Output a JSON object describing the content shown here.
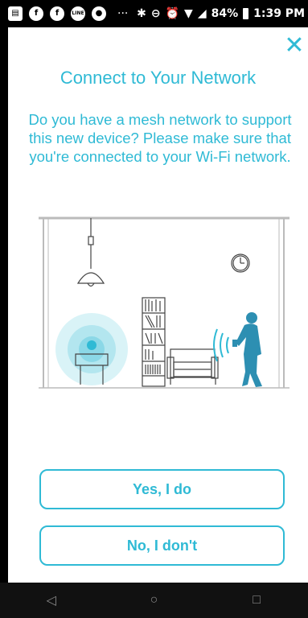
{
  "status_bar": {
    "battery": "84%",
    "time": "1:39 PM",
    "overflow": "···",
    "left_icons": [
      "notes-icon",
      "facebook-icon",
      "facebook-icon",
      "line-icon",
      "messenger-icon"
    ],
    "right_icons": [
      "bluetooth-icon",
      "do-not-disturb-icon",
      "alarm-icon",
      "wifi-icon",
      "signal-icon",
      "battery-icon"
    ]
  },
  "dialog": {
    "title": "Connect to Your Network",
    "description": "Do you have a mesh network to support this new device? Please make sure that you're connected to your Wi-Fi network.",
    "yes_label": "Yes, I do",
    "no_label": "No, I don't",
    "close_icon": "close-icon"
  },
  "illustration": {
    "icons": [
      "pendant-lamp-icon",
      "wall-clock-icon",
      "bookshelf-icon",
      "armchair-icon",
      "router-icon",
      "person-with-phone-icon",
      "wifi-wave-icon"
    ],
    "accent": "#2fbad5"
  },
  "nav_bar": {
    "back": "◁",
    "home": "○",
    "recents": "□"
  },
  "colors": {
    "accent": "#2fbad5",
    "background": "#ffffff",
    "status_bar": "#000000"
  }
}
